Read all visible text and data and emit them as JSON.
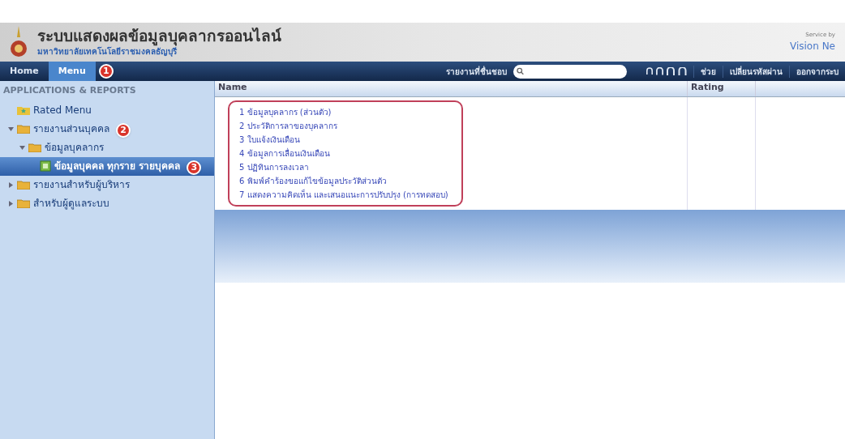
{
  "header": {
    "title": "ระบบแสดงผลข้อมูลบุคลากรออนไลน์",
    "subtitle": "มหาวิทยาลัยเทคโนโลยีราชมงคลธัญบุรี",
    "service_label": "Service by",
    "service_name": "Vision Ne"
  },
  "navbar": {
    "tabs": [
      {
        "label": "Home",
        "selected": false
      },
      {
        "label": "Menu",
        "selected": true
      }
    ],
    "menu_marker": "1",
    "search_label": "รายงานที่ชื่นชอบ",
    "links": [
      "ช่วย",
      "เปลี่ยนรหัสผ่าน",
      "ออกจากระบ"
    ]
  },
  "sidebar": {
    "heading": "APPLICATIONS & REPORTS",
    "items": [
      {
        "label": "Rated Menu",
        "kind": "rated",
        "selected": false
      },
      {
        "label": "รายงานส่วนบุคคล",
        "kind": "folder",
        "expanded": true,
        "selected": false,
        "marker": "2",
        "children": [
          {
            "label": "ข้อมูลบุคลากร",
            "kind": "folder",
            "expanded": true,
            "selected": false,
            "children": [
              {
                "label": "ข้อมูลบุคคล ทุกราย รายบุคคล",
                "kind": "report",
                "selected": true,
                "marker": "3"
              }
            ]
          }
        ]
      },
      {
        "label": "รายงานสำหรับผู้บริหาร",
        "kind": "folder",
        "expanded": false,
        "selected": false
      },
      {
        "label": "สำหรับผู้ดูแลระบบ",
        "kind": "folder",
        "expanded": false,
        "selected": false
      }
    ]
  },
  "table": {
    "columns": [
      "Name",
      "Rating"
    ],
    "rows": [
      "1  ข้อมูลบุคลากร (ส่วนตัว)",
      "2  ประวัติการลาของบุคลากร",
      "3  ใบแจ้งเงินเดือน",
      "4  ข้อมูลการเลื่อนเงินเดือน",
      "5  ปฏิทินการลงเวลา",
      "6  พิมพ์คำร้องขอแก้ไขข้อมูลประวัติส่วนตัว",
      "7  แสดงความคิดเห็น และเสนอแนะการปรับปรุง (การทดสอบ)"
    ]
  }
}
